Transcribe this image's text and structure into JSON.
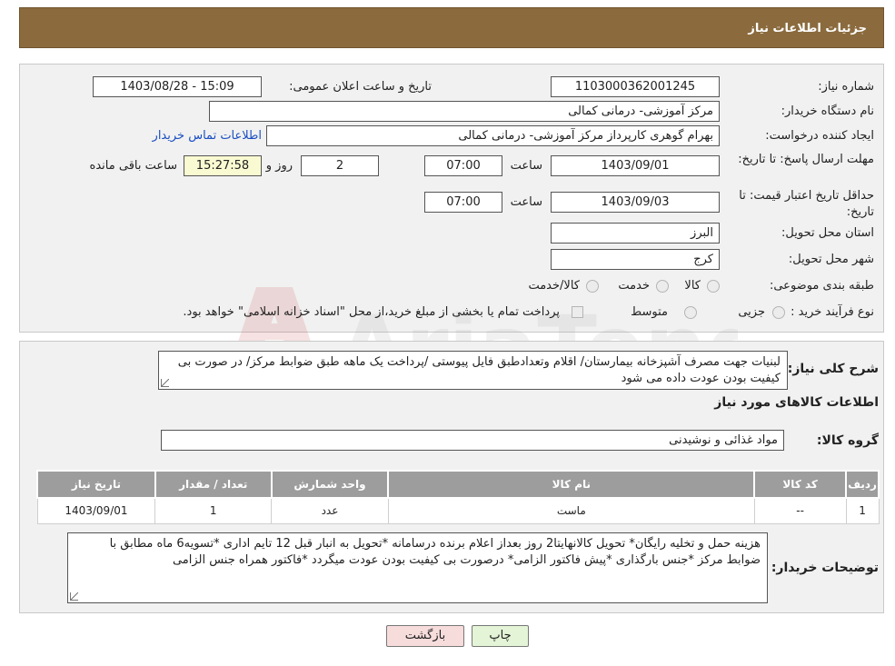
{
  "header": {
    "title": "جزئیات اطلاعات نیاز"
  },
  "form": {
    "need_number_label": "شماره نیاز:",
    "need_number": "1103000362001245",
    "announce_label": "تاریخ و ساعت اعلان عمومی:",
    "announce_value": "1403/08/28 - 15:09",
    "buyer_org_label": "نام دستگاه خریدار:",
    "buyer_org": "مرکز آموزشی- درمانی کمالی",
    "creator_label": "ایجاد کننده درخواست:",
    "creator": "بهرام گوهری کارپرداز مرکز آموزشی- درمانی کمالی",
    "contact_link": "اطلاعات تماس خریدار",
    "deadline_label": "مهلت ارسال پاسخ: تا تاریخ:",
    "deadline_date": "1403/09/01",
    "time_label": "ساعت",
    "deadline_time": "07:00",
    "days_value": "2",
    "days_label": "روز و",
    "remaining_time": "15:27:58",
    "remaining_label": "ساعت باقی مانده",
    "validity_label": "حداقل تاریخ اعتبار قیمت: تا تاریخ:",
    "validity_date": "1403/09/03",
    "validity_time": "07:00",
    "province_label": "استان محل تحویل:",
    "province": "البرز",
    "city_label": "شهر محل تحویل:",
    "city": "کرج",
    "category_label": "طبقه بندی موضوعی:",
    "category_options": [
      "کالا",
      "خدمت",
      "کالا/خدمت"
    ],
    "process_label": "نوع فرآیند خرید :",
    "process_options": [
      "جزیی",
      "متوسط"
    ],
    "payment_note": "پرداخت تمام یا بخشی از مبلغ خرید،از محل \"اسناد خزانه اسلامی\" خواهد بود."
  },
  "description": {
    "label": "شرح کلی نیاز:",
    "text": "لبنیات جهت مصرف آشپزخانه بیمارستان/ اقلام وتعدادطبق فایل پیوستی /پرداخت یک ماهه طبق ضوابط مرکز/ در صورت بی کیفیت بودن عودت داده می شود"
  },
  "goods": {
    "section_title": "اطلاعات کالاهای مورد نیاز",
    "group_label": "گروه کالا:",
    "group_value": "مواد غذائی و نوشیدنی"
  },
  "table": {
    "headers": [
      "ردیف",
      "کد کالا",
      "نام کالا",
      "واحد شمارش",
      "تعداد / مقدار",
      "تاریخ نیاز"
    ],
    "rows": [
      [
        "1",
        "--",
        "ماست",
        "عدد",
        "1",
        "1403/09/01"
      ]
    ]
  },
  "buyer_notes": {
    "label": "توضیحات خریدار:",
    "text": "هزینه حمل و تخلیه رایگان* تحویل کالانهایتا2 روز بعداز اعلام برنده درسامانه *تحویل به انبار قبل 12 تایم اداری *تسویه6 ماه مطابق با ضوابط مرکز *جنس بارگذاری *پیش فاکتور الزامی* درصورت بی کیفیت بودن عودت میگردد *فاکتور همراه جنس الزامی"
  },
  "buttons": {
    "print": "چاپ",
    "back": "بازگشت"
  },
  "colors": {
    "header_bg": "#8b6b3e",
    "print_btn": "#e4f4d6",
    "back_btn": "#f7dcdc"
  }
}
